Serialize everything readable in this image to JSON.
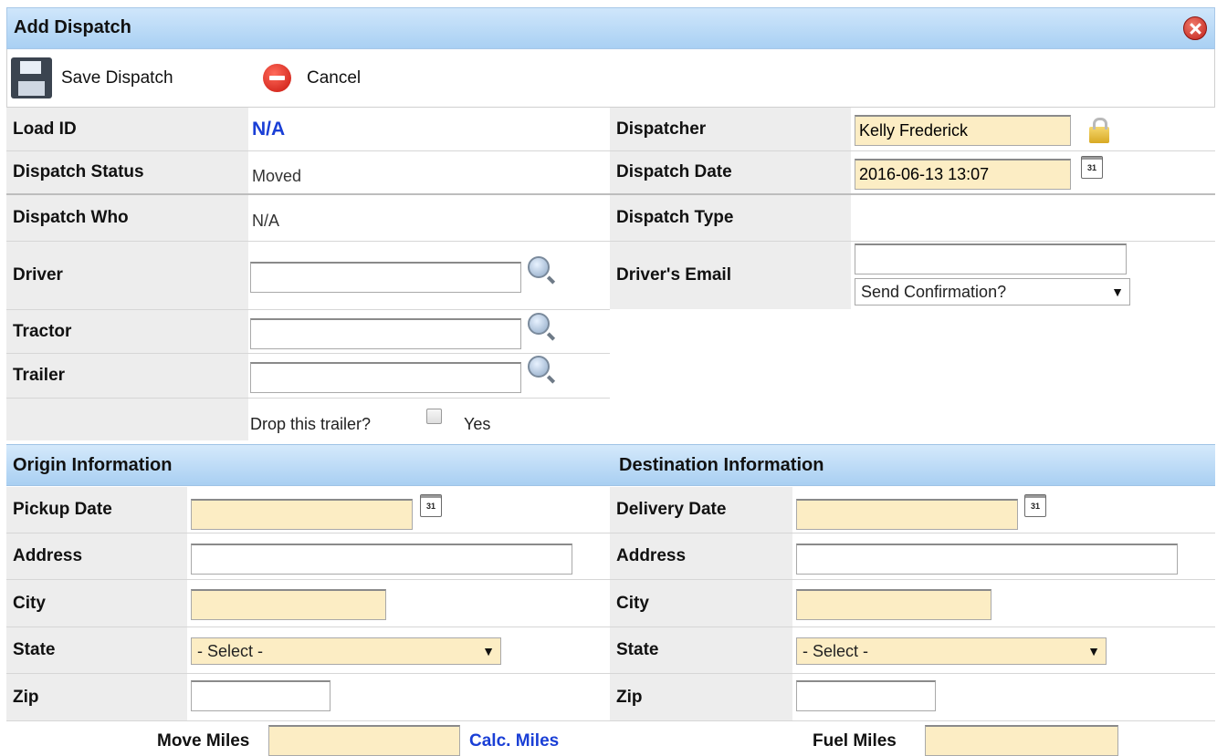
{
  "dialog": {
    "title": "Add Dispatch"
  },
  "toolbar": {
    "save_label": "Save Dispatch",
    "cancel_label": "Cancel"
  },
  "info": {
    "load_id_label": "Load ID",
    "load_id_value": "N/A",
    "dispatch_status_label": "Dispatch Status",
    "dispatch_status_value": "Moved",
    "dispatcher_label": "Dispatcher",
    "dispatcher_value": "Kelly Frederick",
    "dispatch_date_label": "Dispatch Date",
    "dispatch_date_value": "2016-06-13 13:07",
    "calendar_glyph": "31"
  },
  "dispatch": {
    "who_label": "Dispatch Who",
    "who_value": "N/A",
    "type_label": "Dispatch Type",
    "driver_label": "Driver",
    "driver_email_label": "Driver's Email",
    "send_confirmation": "Send Confirmation?",
    "tractor_label": "Tractor",
    "trailer_label": "Trailer",
    "drop_trailer_label": "Drop this trailer?",
    "drop_trailer_yes": "Yes"
  },
  "origin": {
    "heading": "Origin Information",
    "pickup_date_label": "Pickup Date",
    "address_label": "Address",
    "city_label": "City",
    "state_label": "State",
    "state_value": "- Select -",
    "zip_label": "Zip"
  },
  "destination": {
    "heading": "Destination Information",
    "delivery_date_label": "Delivery Date",
    "address_label": "Address",
    "city_label": "City",
    "state_label": "State",
    "state_value": "- Select -",
    "zip_label": "Zip"
  },
  "miles": {
    "move_miles_label": "Move Miles",
    "calc_miles_link": "Calc. Miles",
    "fuel_miles_label": "Fuel Miles"
  },
  "colors": {
    "header_gradient_top": "#cfe6fb",
    "header_gradient_bottom": "#a9d0f3",
    "required_field": "#fcedc4",
    "link": "#1a3fd6"
  }
}
